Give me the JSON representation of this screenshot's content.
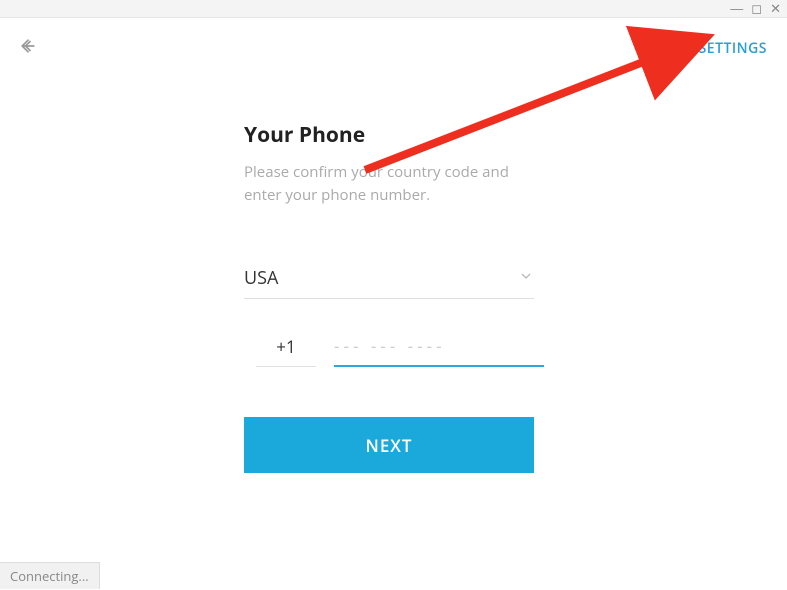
{
  "header": {
    "settings_label": "SETTINGS"
  },
  "form": {
    "title": "Your Phone",
    "subtitle": "Please confirm your country code and enter your phone number.",
    "country": "USA",
    "dial_code": "+1",
    "phone_placeholder": "--- --- ----",
    "next_label": "NEXT"
  },
  "status": {
    "connecting": "Connecting..."
  },
  "window_controls": {
    "minimize": "—",
    "maximize": "◻",
    "close": "✕"
  }
}
